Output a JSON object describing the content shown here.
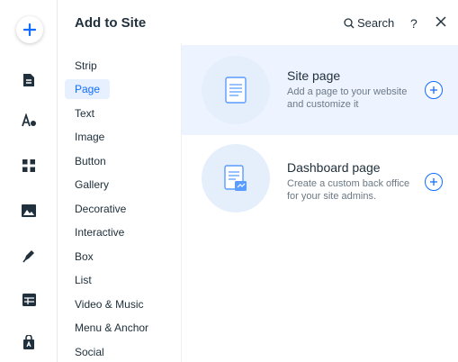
{
  "panel": {
    "title": "Add to Site",
    "search_label": "Search",
    "help_label": "?"
  },
  "rail": {
    "items": [
      {
        "name": "add-elements",
        "icon": "plus-icon"
      },
      {
        "name": "pages",
        "icon": "page-icon"
      },
      {
        "name": "design",
        "icon": "theme-icon"
      },
      {
        "name": "apps",
        "icon": "apps-icon"
      },
      {
        "name": "media",
        "icon": "image-icon"
      },
      {
        "name": "blog",
        "icon": "pen-icon"
      },
      {
        "name": "cms",
        "icon": "table-icon"
      },
      {
        "name": "business",
        "icon": "bag-icon"
      }
    ]
  },
  "categories": [
    {
      "label": "Strip"
    },
    {
      "label": "Page",
      "selected": true
    },
    {
      "label": "Text"
    },
    {
      "label": "Image"
    },
    {
      "label": "Button"
    },
    {
      "label": "Gallery"
    },
    {
      "label": "Decorative"
    },
    {
      "label": "Interactive"
    },
    {
      "label": "Box"
    },
    {
      "label": "List"
    },
    {
      "label": "Video & Music"
    },
    {
      "label": "Menu & Anchor"
    },
    {
      "label": "Social"
    }
  ],
  "cards": [
    {
      "title": "Site page",
      "description": "Add a page to your website and customize it",
      "active": true
    },
    {
      "title": "Dashboard page",
      "description": "Create a custom back office for your site admins.",
      "active": false
    }
  ],
  "colors": {
    "accent": "#116dff",
    "selected_bg": "#e7f0ff",
    "card_highlight": "#edf4ff"
  }
}
